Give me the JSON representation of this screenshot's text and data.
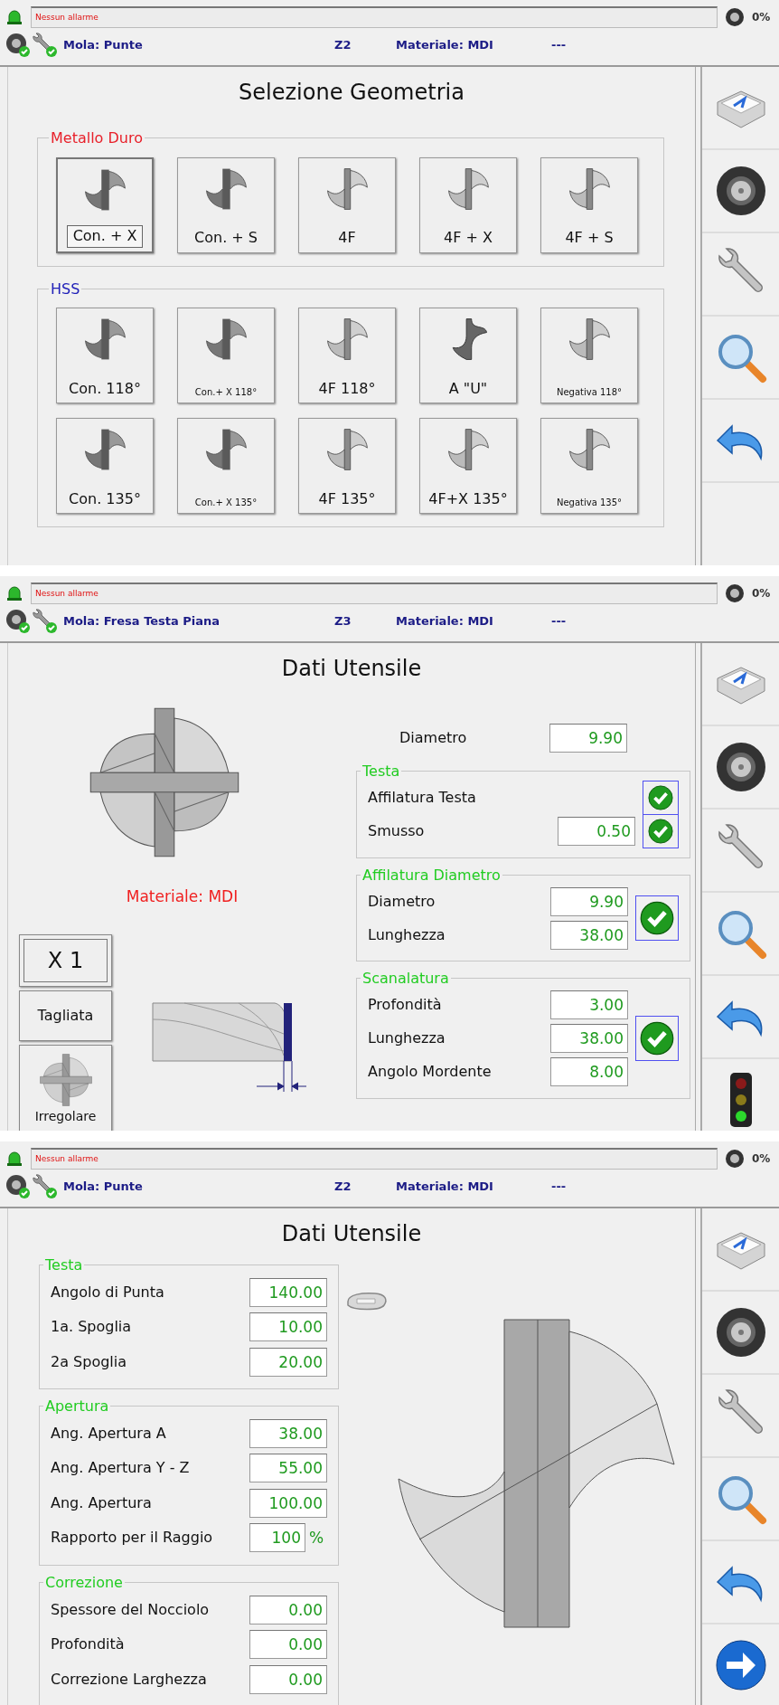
{
  "screens": [
    {
      "kind": "geometry",
      "header": {
        "alarm": "Nessun allarme",
        "progress": "0%",
        "mola": "Mola: Punte",
        "zone": "Z2",
        "material": "Materiale: MDI",
        "extra": "---"
      },
      "title": "Selezione Geometria",
      "groups": [
        {
          "title": "Metallo Duro",
          "color": "#e8202a",
          "rows": [
            [
              {
                "label": "Con. + X",
                "kind": "two",
                "selected": true
              },
              {
                "label": "Con. + S",
                "kind": "two",
                "selected": false
              },
              {
                "label": "4F",
                "kind": "four",
                "selected": false
              },
              {
                "label": "4F + X",
                "kind": "four",
                "selected": false
              },
              {
                "label": "4F + S",
                "kind": "four",
                "selected": false
              }
            ]
          ]
        },
        {
          "title": "HSS",
          "color": "#2020b8",
          "rows": [
            [
              {
                "label": "Con. 118°",
                "kind": "two",
                "selected": false
              },
              {
                "label": "Con.+ X 118°",
                "kind": "two",
                "small": true,
                "selected": false
              },
              {
                "label": "4F 118°",
                "kind": "four",
                "selected": false
              },
              {
                "label": "A \"U\"",
                "kind": "u",
                "selected": false
              },
              {
                "label": "Negativa 118°",
                "kind": "four",
                "small": true,
                "selected": false
              }
            ],
            [
              {
                "label": "Con. 135°",
                "kind": "two",
                "selected": false
              },
              {
                "label": "Con.+ X 135°",
                "kind": "two",
                "small": true,
                "selected": false
              },
              {
                "label": "4F 135°",
                "kind": "four",
                "selected": false
              },
              {
                "label": "4F+X 135°",
                "kind": "four",
                "selected": false
              },
              {
                "label": "Negativa 135°",
                "kind": "four",
                "small": true,
                "selected": false
              }
            ]
          ]
        }
      ],
      "sidebar": [
        {
          "kind": "keyboard"
        },
        {
          "kind": "tire"
        },
        {
          "kind": "wrench"
        },
        {
          "kind": "search"
        },
        {
          "kind": "undo"
        }
      ]
    },
    {
      "kind": "tool-data",
      "header": {
        "alarm": "Nessun allarme",
        "progress": "0%",
        "mola": "Mola: Fresa Testa Piana",
        "zone": "Z3",
        "material": "Materiale: MDI",
        "extra": "---"
      },
      "title": "Dati Utensile",
      "material": "Materiale: MDI",
      "buttons": [
        {
          "label": "X 1",
          "kind": "framed"
        },
        {
          "label": "Tagliata",
          "kind": "plain"
        },
        {
          "label": "Irregolare",
          "kind": "icon"
        }
      ],
      "diameter": {
        "label": "Diametro",
        "value": "9.90"
      },
      "groups": [
        {
          "title": "Testa",
          "rows": [
            {
              "label": "Affilatura Testa",
              "checked": true
            },
            {
              "label": "Smusso",
              "value": "0.50",
              "checked": true
            }
          ]
        },
        {
          "title": "Affilatura Diametro",
          "checked": true,
          "rows": [
            {
              "label": "Diametro",
              "value": "9.90"
            },
            {
              "label": "Lunghezza",
              "value": "38.00"
            }
          ]
        },
        {
          "title": "Scanalatura",
          "checked": true,
          "rows": [
            {
              "label": "Profondità",
              "value": "3.00"
            },
            {
              "label": "Lunghezza",
              "value": "38.00"
            },
            {
              "label": "Angolo Mordente",
              "value": "8.00"
            }
          ]
        }
      ],
      "sidebar": [
        {
          "kind": "keyboard"
        },
        {
          "kind": "tire"
        },
        {
          "kind": "wrench"
        },
        {
          "kind": "search"
        },
        {
          "kind": "undo"
        },
        {
          "kind": "traffic"
        }
      ]
    },
    {
      "kind": "tool-data-drill",
      "header": {
        "alarm": "Nessun allarme",
        "progress": "0%",
        "mola": "Mola: Punte",
        "zone": "Z2",
        "material": "Materiale: MDI",
        "extra": "---"
      },
      "title": "Dati Utensile",
      "groups": [
        {
          "title": "Testa",
          "rows": [
            {
              "label": "Angolo di Punta",
              "value": "140.00"
            },
            {
              "label": "1a. Spoglia",
              "value": "10.00"
            },
            {
              "label": "2a Spoglia",
              "value": "20.00"
            }
          ]
        },
        {
          "title": "Apertura",
          "rows": [
            {
              "label": "Ang. Apertura A",
              "value": "38.00"
            },
            {
              "label": "Ang. Apertura Y - Z",
              "value": "55.00"
            },
            {
              "label": "Ang. Apertura",
              "value": "100.00"
            },
            {
              "label": "Rapporto per il Raggio",
              "value": "100",
              "unit": "%"
            }
          ]
        },
        {
          "title": "Correzione",
          "rows": [
            {
              "label": "Spessore del Nocciolo",
              "value": "0.00"
            },
            {
              "label": "Profondità",
              "value": "0.00"
            },
            {
              "label": "Correzione Larghezza",
              "value": "0.00"
            }
          ]
        }
      ],
      "sidebar": [
        {
          "kind": "keyboard"
        },
        {
          "kind": "tire"
        },
        {
          "kind": "wrench"
        },
        {
          "kind": "search"
        },
        {
          "kind": "undo"
        },
        {
          "kind": "next"
        }
      ]
    }
  ]
}
